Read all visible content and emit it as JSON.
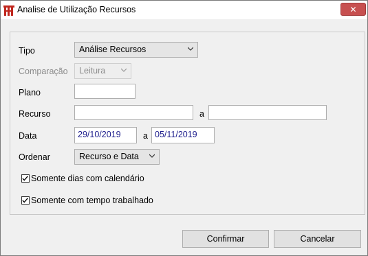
{
  "window": {
    "title": "Analise de Utilização Recursos"
  },
  "form": {
    "tipo": {
      "label": "Tipo",
      "value": "Análise Recursos"
    },
    "comparacao": {
      "label": "Comparação",
      "value": "Leitura"
    },
    "plano": {
      "label": "Plano",
      "value": ""
    },
    "recurso": {
      "label": "Recurso",
      "sep": "a",
      "from": "",
      "to": ""
    },
    "data": {
      "label": "Data",
      "sep": "a",
      "from": "29/10/2019",
      "to": "05/11/2019"
    },
    "ordenar": {
      "label": "Ordenar",
      "value": "Recurso e Data"
    },
    "opt1": {
      "label": "Somente dias com calendário",
      "checked": true
    },
    "opt2": {
      "label": "Somente com tempo trabalhado",
      "checked": true
    }
  },
  "buttons": {
    "confirm": "Confirmar",
    "cancel": "Cancelar"
  },
  "icons": {
    "close": "close-icon",
    "app": "app-icon",
    "chevron": "chevron-down-icon",
    "check": "check-icon"
  },
  "colors": {
    "close_bg": "#c75050",
    "date_text": "#1c1c8c",
    "app_icon": "#c0271e"
  }
}
